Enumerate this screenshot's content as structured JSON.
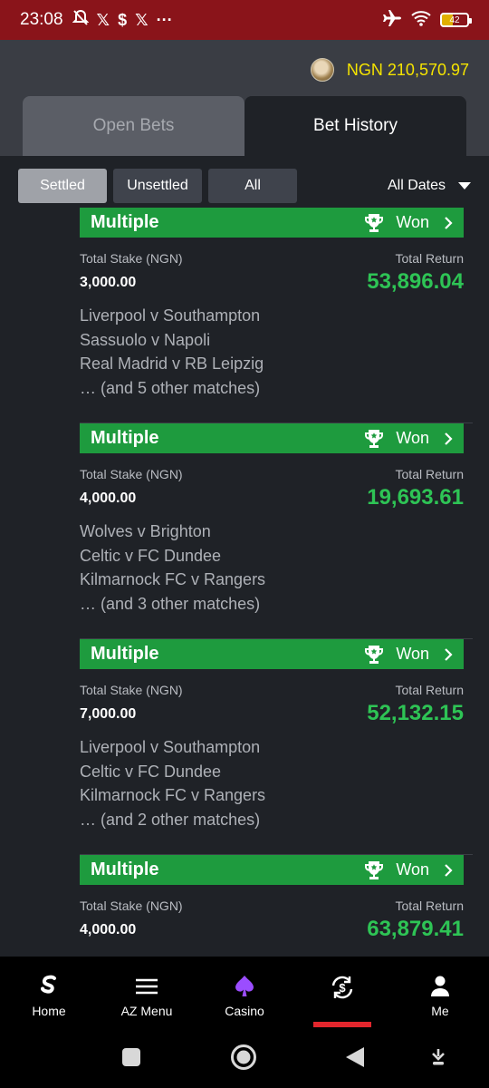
{
  "status_bar": {
    "time": "23:08",
    "battery": "42",
    "bg_color": "#8a141a"
  },
  "header": {
    "balance": "NGN 210,570.97",
    "balance_color": "#f5e400"
  },
  "tabs": [
    {
      "label": "Open Bets",
      "active": false
    },
    {
      "label": "Bet History",
      "active": true
    }
  ],
  "filters": {
    "buttons": [
      {
        "label": "Settled",
        "active": true
      },
      {
        "label": "Unsettled",
        "active": false
      },
      {
        "label": "All",
        "active": false
      }
    ],
    "date_select": "All Dates"
  },
  "bets": [
    {
      "type": "Multiple",
      "status": "Won",
      "stake_label": "Total Stake (NGN)",
      "stake": "3,000.00",
      "return_label": "Total Return",
      "return": "53,896.04",
      "matches": [
        "Liverpool v Southampton",
        "Sassuolo v Napoli",
        "Real Madrid v RB Leipzig",
        "… (and 5 other matches)"
      ]
    },
    {
      "type": "Multiple",
      "status": "Won",
      "stake_label": "Total Stake (NGN)",
      "stake": "4,000.00",
      "return_label": "Total Return",
      "return": "19,693.61",
      "matches": [
        "Wolves v Brighton",
        "Celtic v FC Dundee",
        "Kilmarnock FC v Rangers",
        "… (and 3 other matches)"
      ]
    },
    {
      "type": "Multiple",
      "status": "Won",
      "stake_label": "Total Stake (NGN)",
      "stake": "7,000.00",
      "return_label": "Total Return",
      "return": "52,132.15",
      "matches": [
        "Liverpool v Southampton",
        "Celtic v FC Dundee",
        "Kilmarnock FC v Rangers",
        "… (and 2 other matches)"
      ]
    },
    {
      "type": "Multiple",
      "status": "Won",
      "stake_label": "Total Stake (NGN)",
      "stake": "4,000.00",
      "return_label": "Total Return",
      "return": "63,879.41",
      "matches": []
    }
  ],
  "bottom_nav": [
    {
      "label": "Home",
      "icon": "sportybet-logo-icon"
    },
    {
      "label": "AZ Menu",
      "icon": "hamburger-menu-icon"
    },
    {
      "label": "Casino",
      "icon": "spade-icon"
    },
    {
      "label": "",
      "icon": "bet-history-dollar-icon",
      "active": true
    },
    {
      "label": "Me",
      "icon": "person-icon"
    }
  ],
  "colors": {
    "won_green": "#1e9b3e",
    "return_green": "#2ec455",
    "active_indicator": "#e3262d"
  }
}
